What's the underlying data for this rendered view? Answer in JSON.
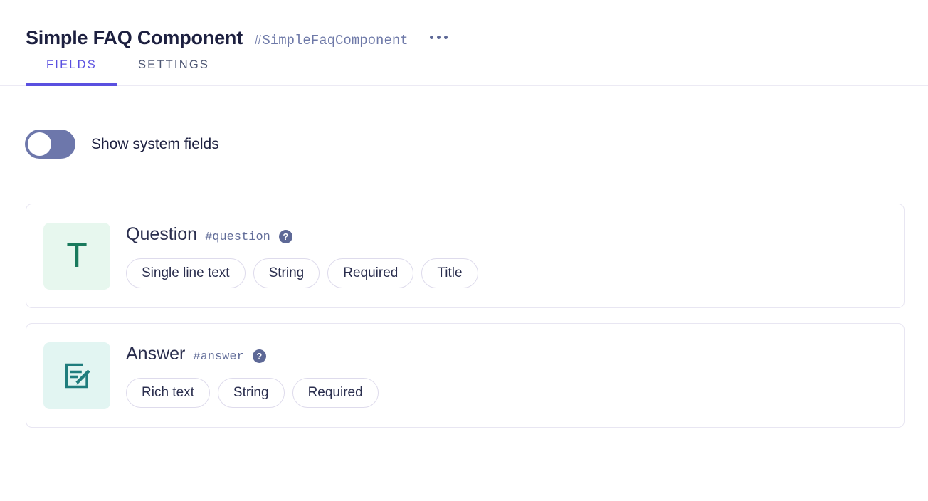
{
  "header": {
    "title": "Simple FAQ Component",
    "component_id": "#SimpleFaqComponent",
    "menu_icon": "kebab-menu-icon"
  },
  "tabs": [
    {
      "label": "FIELDS",
      "active": true
    },
    {
      "label": "SETTINGS",
      "active": false
    }
  ],
  "toggle": {
    "label": "Show system fields",
    "checked": false
  },
  "colors": {
    "accent": "#5a50e0",
    "title": "#1d2040",
    "muted": "#626d99",
    "card_border": "#e8e6f2",
    "toggle_track": "#6d77ab",
    "icon_green_bg": "#e7f7ee",
    "icon_green_fg": "#197a5c",
    "icon_teal_bg": "#e2f5f2",
    "icon_teal_fg": "#1f7d7d"
  },
  "fields": [
    {
      "name": "Question",
      "id": "#question",
      "icon": "text-t-icon",
      "icon_style": "green",
      "help": "?",
      "tags": [
        "Single line text",
        "String",
        "Required",
        "Title"
      ]
    },
    {
      "name": "Answer",
      "id": "#answer",
      "icon": "rich-text-edit-icon",
      "icon_style": "teal",
      "help": "?",
      "tags": [
        "Rich text",
        "String",
        "Required"
      ]
    }
  ]
}
